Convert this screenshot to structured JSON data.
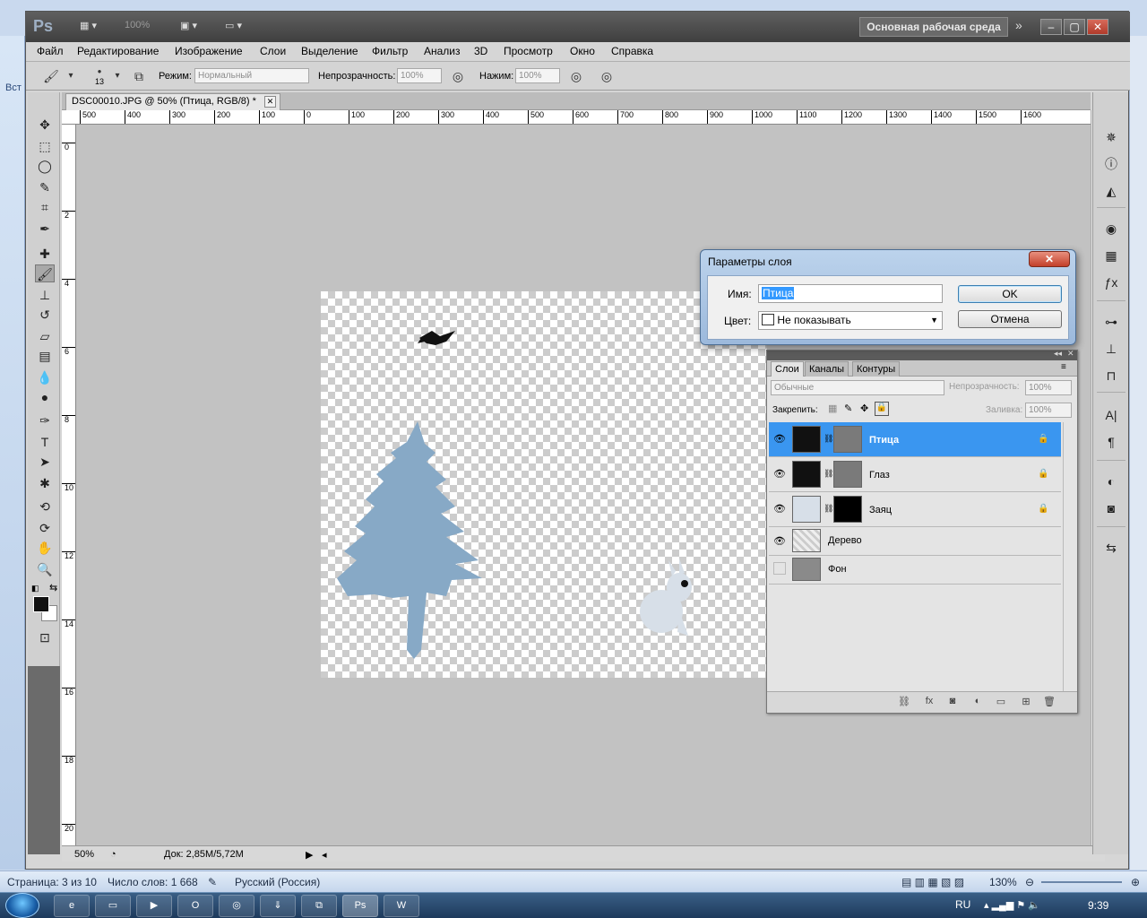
{
  "word": {
    "left_label": "Вст",
    "status": {
      "page": "Страница: 3 из 10",
      "words": "Число слов: 1 668",
      "language": "Русский (Россия)",
      "zoom": "130%"
    }
  },
  "taskbar": {
    "lang": "RU",
    "clock": "9:39"
  },
  "ps": {
    "logo": "Ps",
    "zoom_ctl": "100%",
    "workspace": "Основная рабочая среда",
    "menu": [
      "Файл",
      "Редактирование",
      "Изображение",
      "Слои",
      "Выделение",
      "Фильтр",
      "Анализ",
      "3D",
      "Просмотр",
      "Окно",
      "Справка"
    ],
    "options": {
      "brush_size": "13",
      "mode_label": "Режим:",
      "mode_value": "Нормальный",
      "opacity_label": "Непрозрачность:",
      "opacity_value": "100%",
      "flow_label": "Нажим:",
      "flow_value": "100%"
    },
    "doc": {
      "tab_title": "DSC00010.JPG @ 50% (Птица, RGB/8) *",
      "status_zoom": "50%",
      "status_doc": "Док: 2,85M/5,72M",
      "h_ruler": [
        "500",
        "400",
        "300",
        "200",
        "100",
        "0",
        "100",
        "200",
        "300",
        "400",
        "500",
        "600",
        "700",
        "800",
        "900",
        "1000",
        "1100",
        "1200",
        "1300",
        "1400",
        "1500",
        "1600"
      ],
      "v_ruler": [
        "0",
        "2",
        "4",
        "6",
        "8",
        "10",
        "12",
        "14",
        "16",
        "18",
        "20"
      ]
    },
    "layers": {
      "tabs": [
        "Слои",
        "Каналы",
        "Контуры"
      ],
      "blend_mode": "Обычные",
      "opacity_label": "Непрозрачность:",
      "opacity_value": "100%",
      "lock_label": "Закрепить:",
      "fill_label": "Заливка:",
      "fill_value": "100%",
      "rows": [
        {
          "name": "Птица",
          "selected": true
        },
        {
          "name": "Глаз",
          "selected": false
        },
        {
          "name": "Заяц",
          "selected": false
        },
        {
          "name": "Дерево",
          "selected": false
        },
        {
          "name": "Фон",
          "selected": false
        }
      ]
    },
    "dialog": {
      "title": "Параметры слоя",
      "name_label": "Имя:",
      "name_value": "Птица",
      "color_label": "Цвет:",
      "color_value": "Не показывать",
      "ok": "OK",
      "cancel": "Отмена"
    },
    "colors": {
      "tree": "#87a9c6",
      "hare": "#d7dfe8",
      "selection": "#3a96f0"
    }
  }
}
